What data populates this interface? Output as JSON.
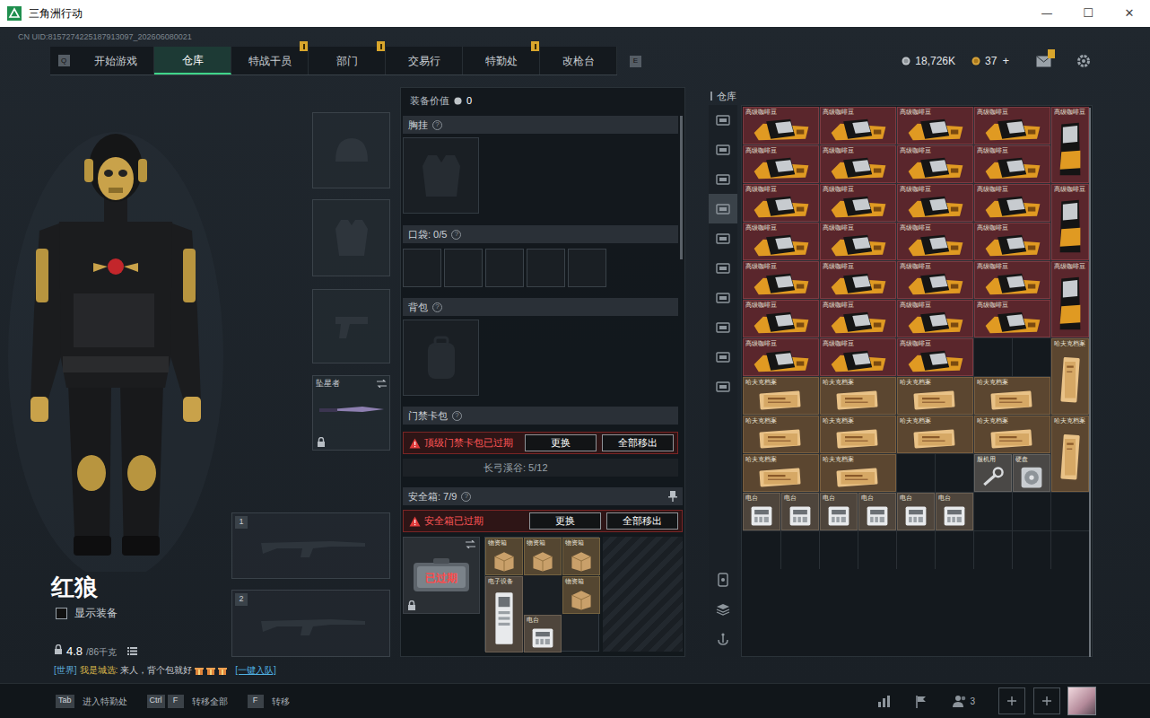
{
  "window": {
    "title": "三角洲行动",
    "controls": [
      "—",
      "☐",
      "✕"
    ]
  },
  "uid": "CN UID:8157274225187913097_202606080021",
  "nav": {
    "prev_key": "Q",
    "next_key": "E",
    "tabs": [
      {
        "label": "开始游戏",
        "selected": false,
        "badge": false
      },
      {
        "label": "仓库",
        "selected": true,
        "badge": false
      },
      {
        "label": "特战干员",
        "selected": false,
        "badge": true
      },
      {
        "label": "部门",
        "selected": false,
        "badge": true
      },
      {
        "label": "交易行",
        "selected": false,
        "badge": false
      },
      {
        "label": "特勤处",
        "selected": false,
        "badge": true
      },
      {
        "label": "改枪台",
        "selected": false,
        "badge": false
      }
    ]
  },
  "wallet": {
    "silver": "18,726K",
    "gold": "37",
    "add": "+",
    "mail_badge": true
  },
  "character": {
    "name": "红狼",
    "show_equipment": {
      "label": "显示装备",
      "checked": false
    },
    "weight": "4.8",
    "capacity": "/86千克"
  },
  "slots": {
    "melee": {
      "label": "坠星者",
      "locked": true
    },
    "weapons": [
      "1",
      "2"
    ]
  },
  "chat": {
    "channel": "[世界]",
    "sender": "我是城选:",
    "message": "来人，背个包就好",
    "link": "[一键入队]"
  },
  "loadout": {
    "value_label": "装备价值",
    "value": "0",
    "chest": {
      "label": "胸挂",
      "help": "?"
    },
    "pockets": {
      "label": "口袋: 0/5",
      "help": "?"
    },
    "backpack": {
      "label": "背包",
      "help": "?"
    },
    "keycard": {
      "label": "门禁卡包",
      "help": "?",
      "warning": "顶级门禁卡包已过期",
      "buttons": [
        "更换",
        "全部移出"
      ],
      "next_row": "长弓溪谷: 5/12"
    },
    "safe": {
      "label": "安全箱: 7/9",
      "help": "?",
      "warning": "安全箱已过期",
      "buttons": [
        "更换",
        "全部移出"
      ],
      "case_label": "已过期",
      "case_locked": true,
      "items": [
        {
          "kind": "box",
          "label": "物资箱",
          "rotated": false
        },
        {
          "kind": "box",
          "label": "物资箱",
          "rotated": false
        },
        {
          "kind": "box",
          "label": "物资箱",
          "rotated": false
        },
        {
          "kind": "device",
          "label": "电子设备",
          "rotated": true
        },
        {
          "kind": "empty",
          "label": "",
          "rotated": false
        },
        {
          "kind": "box",
          "label": "物资箱",
          "rotated": false
        },
        {
          "kind": "device",
          "label": "电台",
          "rotated": false
        }
      ]
    }
  },
  "warehouse": {
    "title": "仓库",
    "tabs": [
      {
        "selected": false
      },
      {
        "selected": false
      },
      {
        "selected": false
      },
      {
        "selected": true
      },
      {
        "selected": false
      },
      {
        "selected": false
      },
      {
        "selected": false
      },
      {
        "selected": false
      },
      {
        "selected": false
      },
      {
        "selected": false
      }
    ],
    "items": [
      {
        "kind": "coffee",
        "label": "高级咖啡豆",
        "rotated": false
      },
      {
        "kind": "coffee",
        "label": "高级咖啡豆",
        "rotated": false
      },
      {
        "kind": "coffee",
        "label": "高级咖啡豆",
        "rotated": false
      },
      {
        "kind": "coffee",
        "label": "高级咖啡豆",
        "rotated": false
      },
      {
        "kind": "coffee",
        "label": "高级咖啡豆",
        "rotated": true
      },
      {
        "kind": "coffee",
        "label": "高级咖啡豆",
        "rotated": false
      },
      {
        "kind": "coffee",
        "label": "高级咖啡豆",
        "rotated": false
      },
      {
        "kind": "coffee",
        "label": "高级咖啡豆",
        "rotated": false
      },
      {
        "kind": "coffee",
        "label": "高级咖啡豆",
        "rotated": false
      },
      {
        "kind": "coffee",
        "label": "高级咖啡豆",
        "rotated": false
      },
      {
        "kind": "coffee",
        "label": "高级咖啡豆",
        "rotated": false
      },
      {
        "kind": "coffee",
        "label": "高级咖啡豆",
        "rotated": false
      },
      {
        "kind": "coffee",
        "label": "高级咖啡豆",
        "rotated": false
      },
      {
        "kind": "coffee",
        "label": "高级咖啡豆",
        "rotated": true
      },
      {
        "kind": "coffee",
        "label": "高级咖啡豆",
        "rotated": false
      },
      {
        "kind": "coffee",
        "label": "高级咖啡豆",
        "rotated": false
      },
      {
        "kind": "coffee",
        "label": "高级咖啡豆",
        "rotated": false
      },
      {
        "kind": "coffee",
        "label": "高级咖啡豆",
        "rotated": false
      },
      {
        "kind": "coffee",
        "label": "高级咖啡豆",
        "rotated": false
      },
      {
        "kind": "coffee",
        "label": "高级咖啡豆",
        "rotated": false
      },
      {
        "kind": "coffee",
        "label": "高级咖啡豆",
        "rotated": false
      },
      {
        "kind": "coffee",
        "label": "高级咖啡豆",
        "rotated": false
      },
      {
        "kind": "coffee",
        "label": "高级咖啡豆",
        "rotated": true
      },
      {
        "kind": "coffee",
        "label": "高级咖啡豆",
        "rotated": false
      },
      {
        "kind": "coffee",
        "label": "高级咖啡豆",
        "rotated": false
      },
      {
        "kind": "coffee",
        "label": "高级咖啡豆",
        "rotated": false
      },
      {
        "kind": "coffee",
        "label": "高级咖啡豆",
        "rotated": false
      },
      {
        "kind": "coffee",
        "label": "高级咖啡豆",
        "rotated": false
      },
      {
        "kind": "coffee",
        "label": "高级咖啡豆",
        "rotated": false
      },
      {
        "kind": "coffee",
        "label": "高级咖啡豆",
        "rotated": false
      },
      {
        "kind": "empty",
        "label": "",
        "rotated": false
      },
      {
        "kind": "empty",
        "label": "",
        "rotated": false
      },
      {
        "kind": "doc",
        "label": "哈夫克档案",
        "rotated": true
      },
      {
        "kind": "doc",
        "label": "哈夫克档案",
        "rotated": false
      },
      {
        "kind": "doc",
        "label": "哈夫克档案",
        "rotated": false
      },
      {
        "kind": "doc",
        "label": "哈夫克档案",
        "rotated": false
      },
      {
        "kind": "doc",
        "label": "哈夫克档案",
        "rotated": false
      },
      {
        "kind": "doc",
        "label": "哈夫克档案",
        "rotated": false
      },
      {
        "kind": "doc",
        "label": "哈夫克档案",
        "rotated": false
      },
      {
        "kind": "doc",
        "label": "哈夫克档案",
        "rotated": false
      },
      {
        "kind": "doc",
        "label": "哈夫克档案",
        "rotated": false
      },
      {
        "kind": "doc",
        "label": "哈夫克档案",
        "rotated": true
      },
      {
        "kind": "doc",
        "label": "哈夫克档案",
        "rotated": false
      },
      {
        "kind": "doc",
        "label": "哈夫克档案",
        "rotated": false
      },
      {
        "kind": "empty",
        "label": "",
        "rotated": false
      },
      {
        "kind": "empty",
        "label": "",
        "rotated": false
      },
      {
        "kind": "tool",
        "label": "服机用",
        "rotated": false
      },
      {
        "kind": "disc",
        "label": "硬盘",
        "rotated": false
      },
      {
        "kind": "device",
        "label": "电台",
        "rotated": false
      },
      {
        "kind": "device",
        "label": "电台",
        "rotated": false
      },
      {
        "kind": "device",
        "label": "电台",
        "rotated": false
      },
      {
        "kind": "device",
        "label": "电台",
        "rotated": false
      },
      {
        "kind": "device",
        "label": "电台",
        "rotated": false
      },
      {
        "kind": "device",
        "label": "电台",
        "rotated": false
      }
    ]
  },
  "bottom_bar": {
    "hints": [
      {
        "keys": [
          "Tab"
        ],
        "label": "进入特勤处"
      },
      {
        "keys": [
          "Ctrl",
          "F"
        ],
        "label": "转移全部"
      },
      {
        "keys": [
          "F"
        ],
        "label": "转移"
      }
    ],
    "friends": "3"
  }
}
